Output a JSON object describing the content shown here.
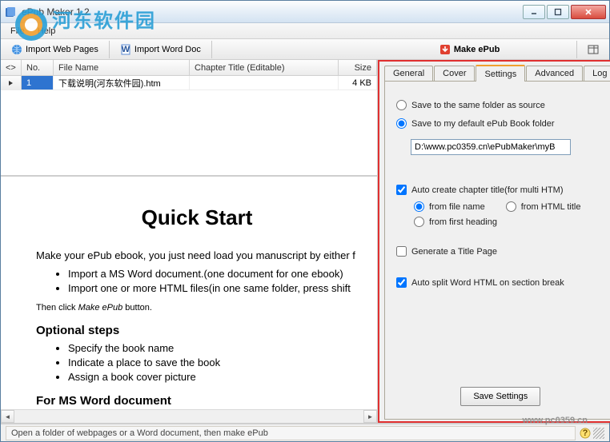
{
  "window": {
    "title": "ePub Maker 1.2"
  },
  "menu": {
    "file": "File",
    "help": "Help"
  },
  "toolbar": {
    "import_web": "Import Web Pages",
    "import_word": "Import Word Doc",
    "make_epub": "Make ePub"
  },
  "grid": {
    "headers": {
      "c0": "<>",
      "c1": "No.",
      "c2": "File Name",
      "c3": "Chapter Title (Editable)",
      "c4": "Size"
    },
    "rows": [
      {
        "no": "1",
        "file": "下载说明(河东软件园).htm",
        "title": "",
        "size": "4 KB"
      }
    ]
  },
  "preview": {
    "h1": "Quick Start",
    "p1_a": "Make your ePub ebook, you just need load you manuscript by either f",
    "li1": "Import a MS Word document.(one document for one ebook)",
    "li2": "Import one or more HTML files(in one same folder, press shift",
    "p2_a": "Then click ",
    "p2_em": "Make ePub",
    "p2_b": " button.",
    "h3a": "Optional steps",
    "li3": "Specify the book name",
    "li4": "Indicate a place to save the book",
    "li5": "Assign a book cover picture",
    "h3b": "For MS Word document"
  },
  "tabs": {
    "general": "General",
    "cover": "Cover",
    "settings": "Settings",
    "advanced": "Advanced",
    "log": "Log"
  },
  "settings": {
    "save_same": "Save to the same folder as source",
    "save_default": "Save to my default ePub Book folder",
    "path": "D:\\www.pc0359.cn\\ePubMaker\\myB",
    "auto_chapter": "Auto create chapter title(for multi HTM)",
    "from_file": "from file name",
    "from_html": "from HTML title",
    "from_heading": "from first heading",
    "gen_title": "Generate a Title Page",
    "auto_split": "Auto split Word HTML on section break",
    "save_btn": "Save Settings"
  },
  "status": {
    "text": "Open a folder of webpages or a Word document, then make ePub"
  },
  "watermark": {
    "brand": "河东软件园",
    "url": "www.pc0359.cn"
  }
}
